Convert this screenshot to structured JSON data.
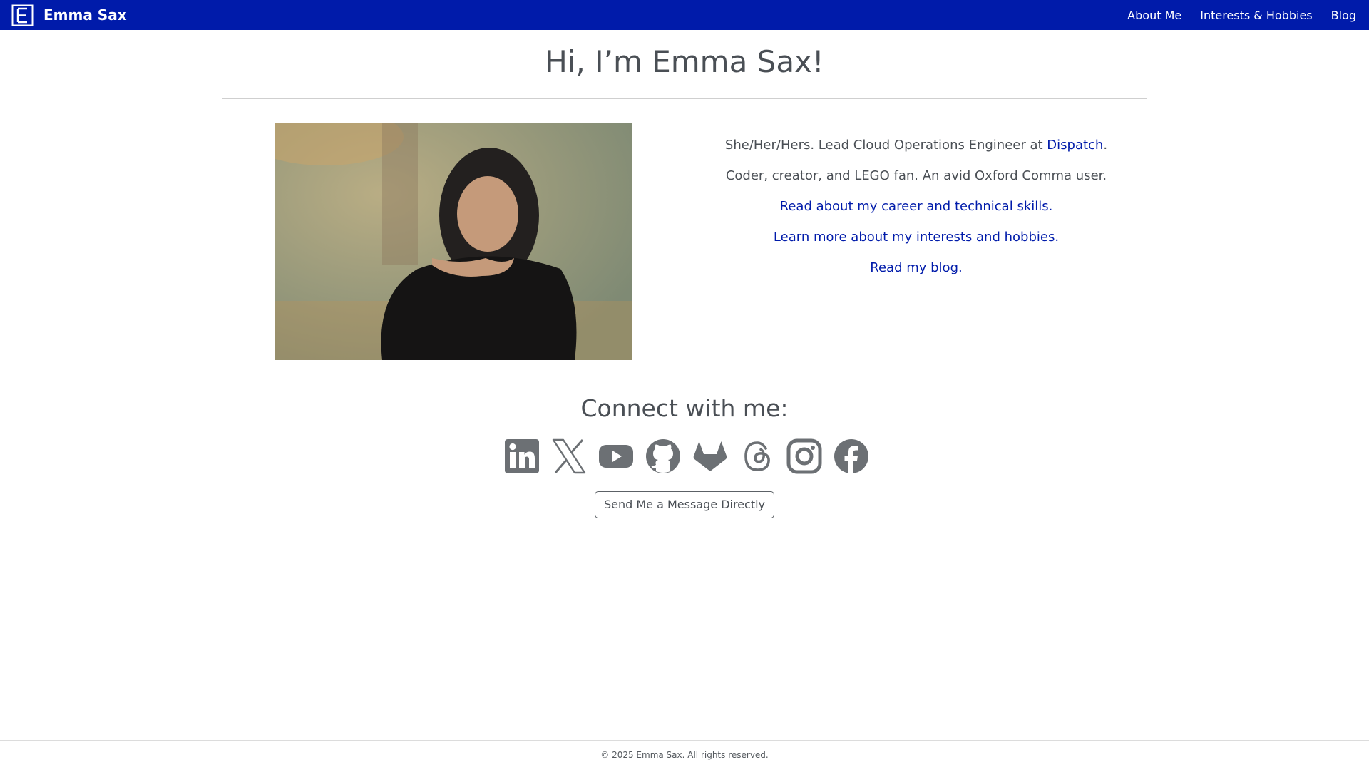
{
  "nav": {
    "brand_name": "Emma Sax",
    "links": [
      {
        "label": "About Me"
      },
      {
        "label": "Interests & Hobbies"
      },
      {
        "label": "Blog"
      }
    ]
  },
  "hero": {
    "title": "Hi, I’m Emma Sax!"
  },
  "bio": {
    "pronouns_line_prefix": "She/Her/Hers. Lead Cloud Operations Engineer at ",
    "employer_link": "Dispatch",
    "pronouns_line_suffix": ".",
    "tagline": "Coder, creator, and LEGO fan. An avid Oxford Comma user.",
    "career_link": "Read about my career and technical skills.",
    "interests_link": "Learn more about my interests and hobbies.",
    "blog_link": "Read my blog."
  },
  "connect": {
    "title": "Connect with me:",
    "icons": [
      "linkedin-icon",
      "x-icon",
      "youtube-icon",
      "github-icon",
      "gitlab-icon",
      "threads-icon",
      "instagram-icon",
      "facebook-icon"
    ],
    "message_button": "Send Me a Message Directly"
  },
  "footer": {
    "copyright": "© 2025 Emma Sax. All rights reserved."
  },
  "colors": {
    "navbar": "#001baa",
    "link": "#001baa",
    "text": "#4a4f55",
    "icon": "#6c7074"
  }
}
